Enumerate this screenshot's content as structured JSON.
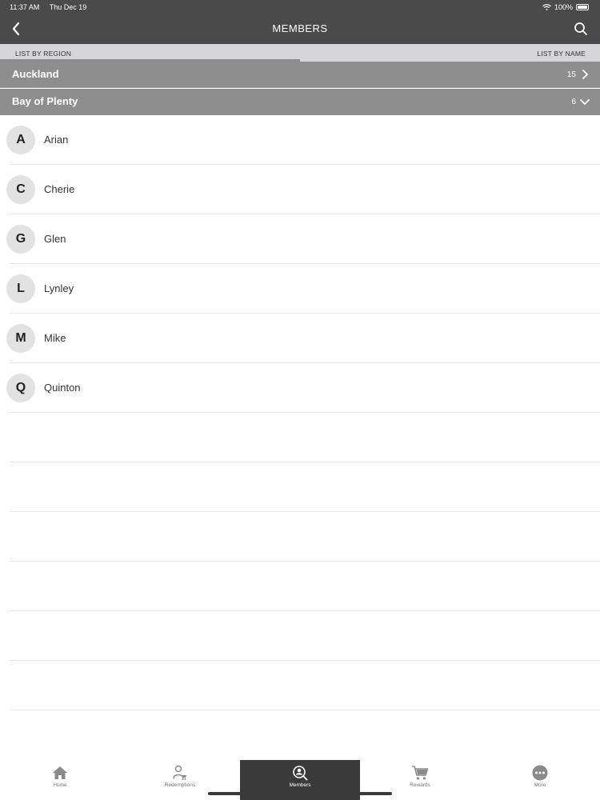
{
  "status_bar": {
    "time": "11:37 AM",
    "date": "Thu Dec 19",
    "battery": "100%"
  },
  "nav": {
    "title": "MEMBERS",
    "back_icon": "chevron-left-icon",
    "search_icon": "search-icon"
  },
  "segments": {
    "left_label": "LIST BY REGION",
    "right_label": "LIST BY NAME",
    "selected": "LIST BY REGION"
  },
  "regions": [
    {
      "name": "Auckland",
      "count": "15",
      "expanded": false
    },
    {
      "name": "Bay of Plenty",
      "count": "6",
      "expanded": true
    }
  ],
  "members": [
    {
      "initial": "A",
      "name": "Arian"
    },
    {
      "initial": "C",
      "name": "Cherie"
    },
    {
      "initial": "G",
      "name": "Glen"
    },
    {
      "initial": "L",
      "name": "Lynley"
    },
    {
      "initial": "M",
      "name": "Mike"
    },
    {
      "initial": "Q",
      "name": "Quinton"
    }
  ],
  "tabs": [
    {
      "label": "Home",
      "icon": "home-icon"
    },
    {
      "label": "Redemptions",
      "icon": "user-cart-icon"
    },
    {
      "label": "Members",
      "icon": "search-user-icon",
      "active": true
    },
    {
      "label": "Rewards",
      "icon": "cart-icon"
    },
    {
      "label": "More",
      "icon": "more-icon"
    }
  ],
  "colors": {
    "nav_bg": "#4a4a4a",
    "segment_bg": "#d6d6d8",
    "region_bg": "#8e8e8e",
    "active_tab_bg": "#3a3a3a"
  }
}
